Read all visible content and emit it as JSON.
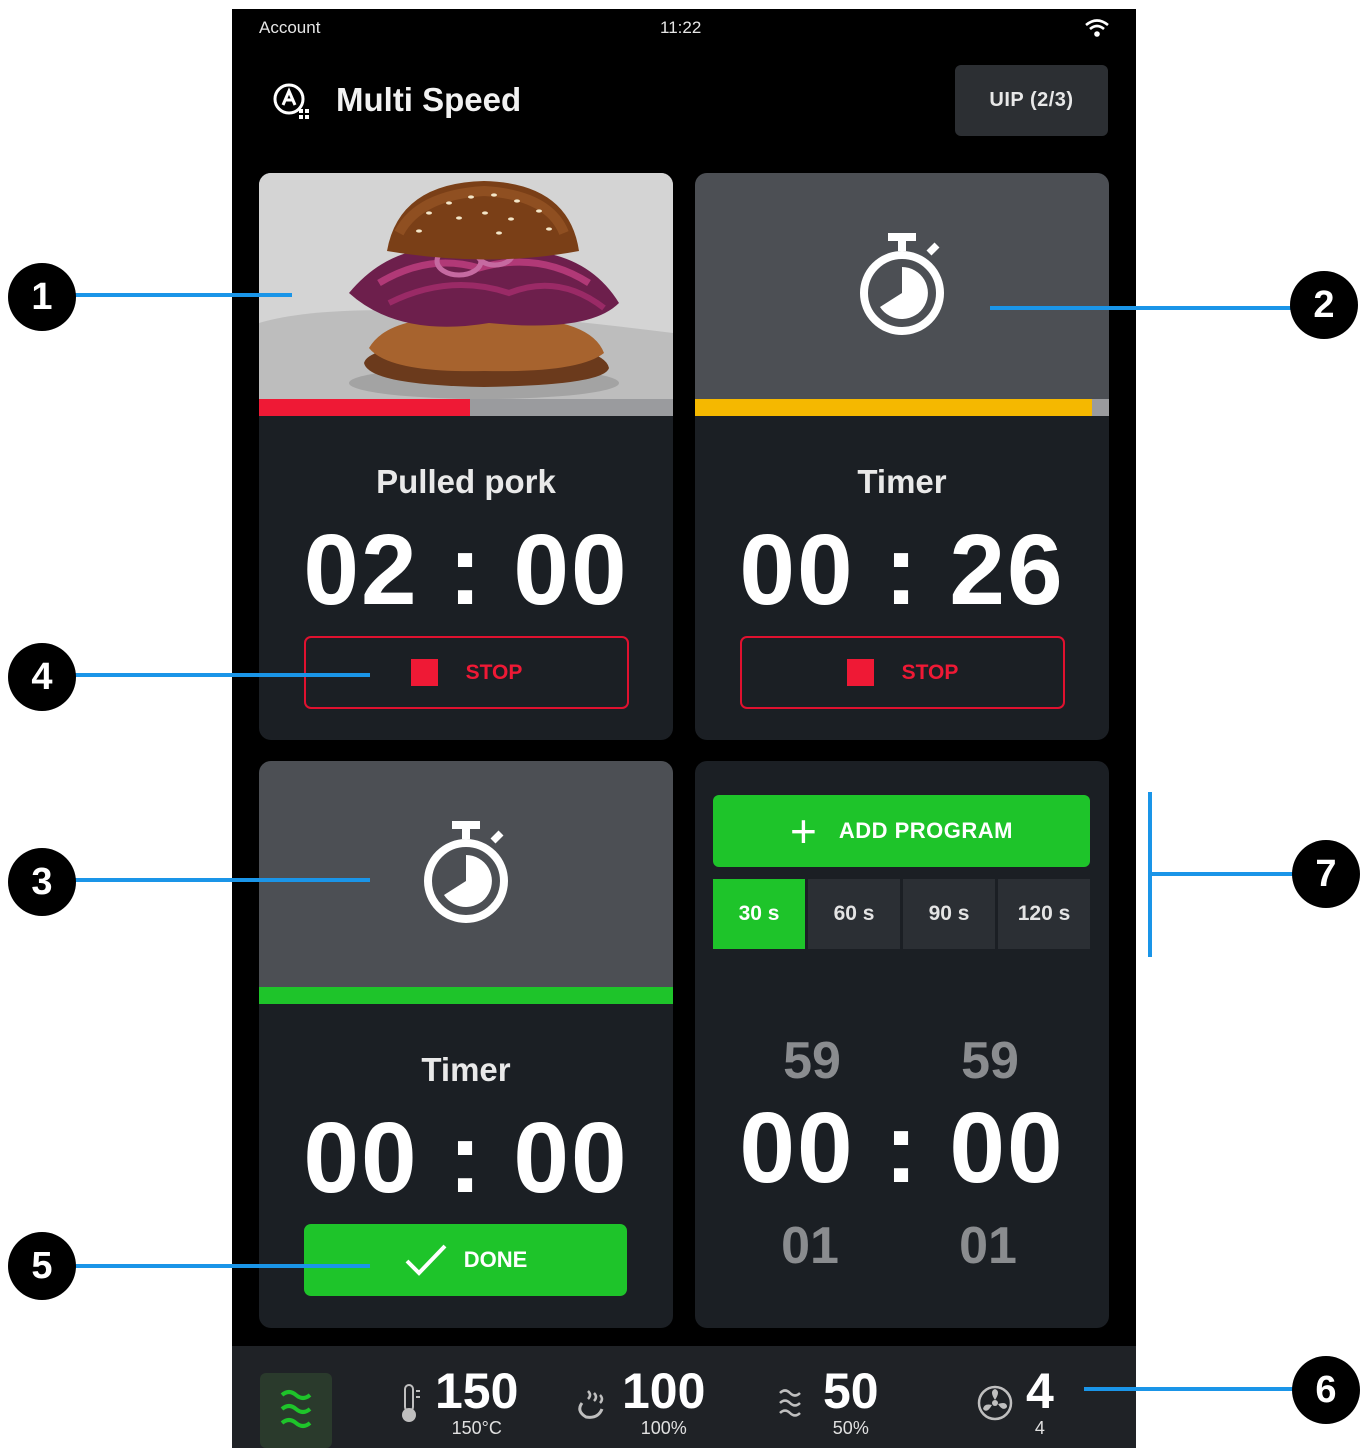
{
  "status": {
    "account": "Account",
    "time": "11:22"
  },
  "header": {
    "title": "Multi Speed",
    "uip_label": "UIP (2/3)"
  },
  "cards": [
    {
      "name": "Pulled pork",
      "time": "02 : 00",
      "progress": 0.51,
      "progress_color": "#ef1935",
      "button": "STOP"
    },
    {
      "name": "Timer",
      "time": "00 : 26",
      "progress": 0.96,
      "progress_color": "#f5b800",
      "button": "STOP"
    },
    {
      "name": "Timer",
      "time": "00 : 00",
      "progress": 1.0,
      "progress_color": "#1ec42a",
      "button": "DONE"
    }
  ],
  "add_program": {
    "label": "ADD PROGRAM",
    "durations": [
      "30 s",
      "60 s",
      "90 s",
      "120 s"
    ],
    "selected": "30 s",
    "time": "00 : 00",
    "wheel_above": [
      "59",
      "59"
    ],
    "wheel_below": [
      "01",
      "01"
    ]
  },
  "bottom_bar": {
    "temperature": {
      "value": "150",
      "sub": "150°C"
    },
    "steam": {
      "value": "100",
      "sub": "100%"
    },
    "microwave": {
      "value": "50",
      "sub": "50%"
    },
    "fan": {
      "value": "4",
      "sub": "4"
    }
  },
  "callouts": [
    "1",
    "2",
    "3",
    "4",
    "5",
    "6",
    "7"
  ],
  "colors": {
    "accent_green": "#1ec42a",
    "stop_red": "#ef1935",
    "timer_yellow": "#f5b800",
    "callout_line": "#1a95e8"
  }
}
